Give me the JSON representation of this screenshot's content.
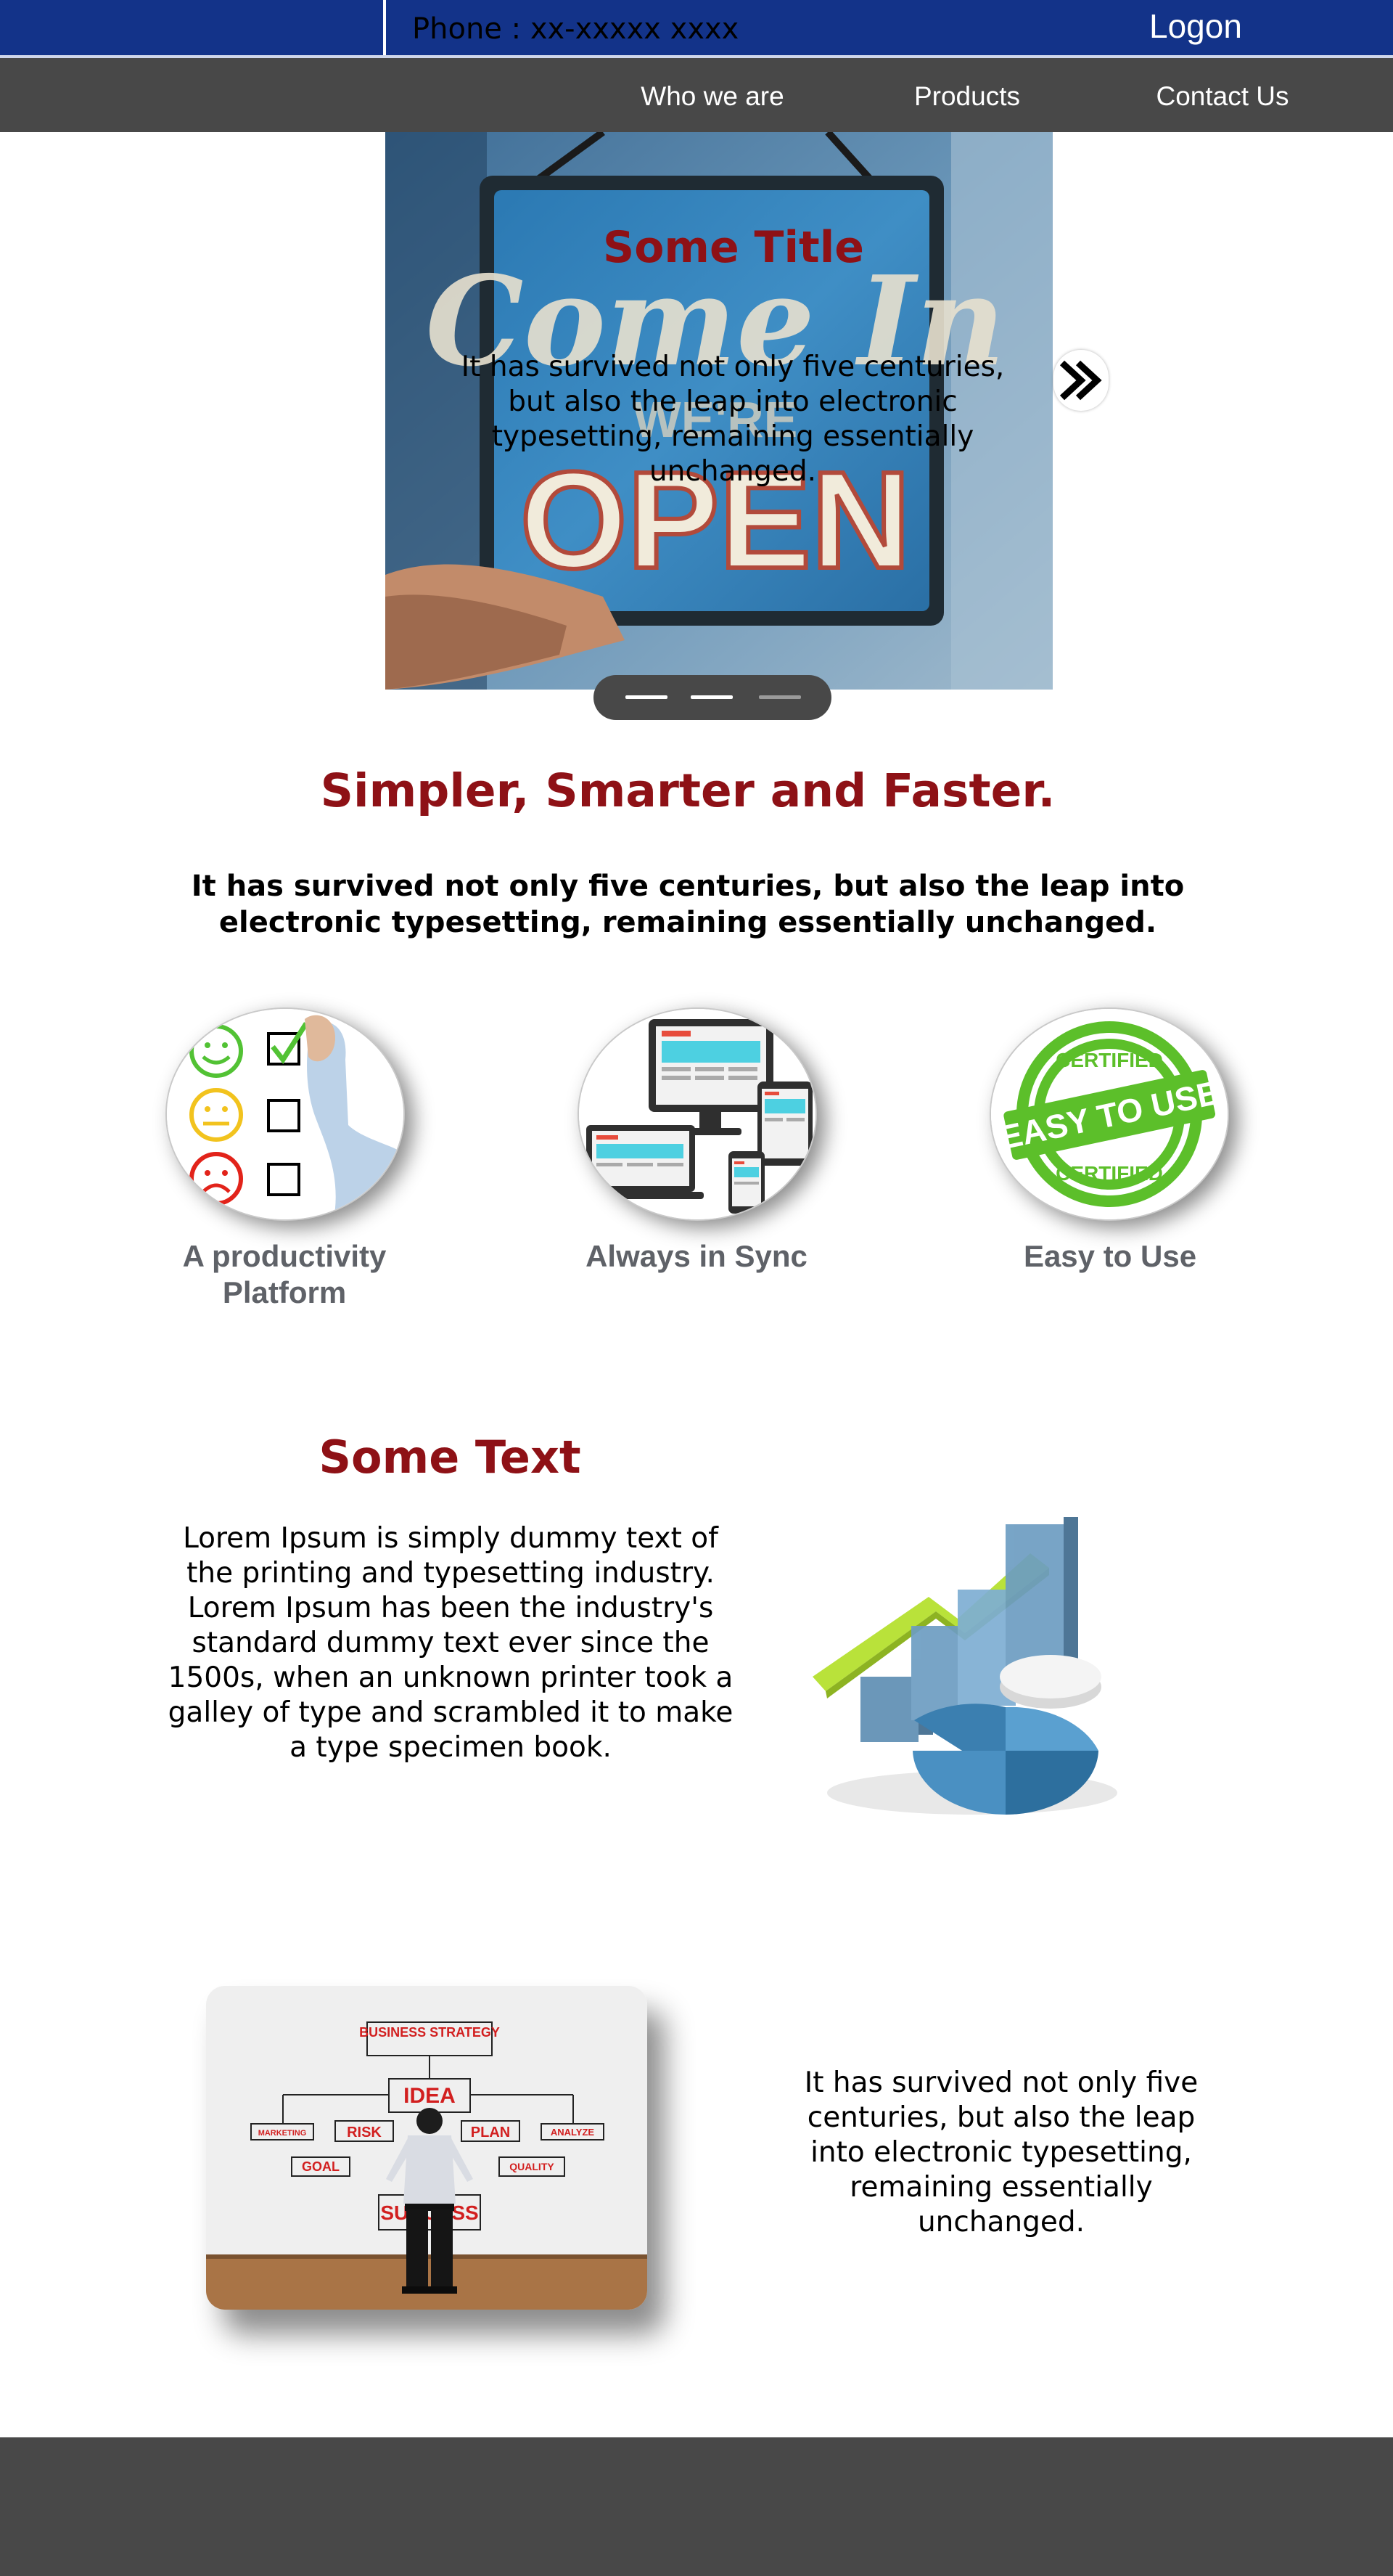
{
  "header": {
    "phone": "Phone : xx-xxxxx xxxx",
    "logon": "Logon",
    "bar_color": "#133389"
  },
  "nav": {
    "items": [
      "Who we are",
      "Products",
      "Contact Us"
    ],
    "bg_color": "#484848"
  },
  "hero": {
    "title": "Some Title",
    "text": "It has survived not only five centuries, but also the leap into electronic typesetting, remaining essentially unchanged.",
    "sign_words": [
      "Come In",
      "WE'RE",
      "OPEN"
    ],
    "next_icon": "double-chevron-right-icon",
    "slide_count": 3,
    "active_slide": 3
  },
  "intro": {
    "headline": "Simpler, Smarter and Faster.",
    "subline": "It has survived not only five centuries, but also the leap into electronic typesetting, remaining essentially unchanged."
  },
  "features": [
    {
      "label": "A productivity Platform",
      "icon": "feedback-checklist-icon"
    },
    {
      "label": "Always in Sync",
      "icon": "devices-sync-icon"
    },
    {
      "label": "Easy to Use",
      "icon": "certified-stamp-icon"
    }
  ],
  "certified_stamp": {
    "top": "CERTIFIED",
    "middle": "EASY TO USE",
    "bottom": "CERTIFIED"
  },
  "content": {
    "title": "Some Text",
    "body": "Lorem Ipsum is simply dummy text of the printing and typesetting industry. Lorem Ipsum has been the industry's standard dummy text ever since the 1500s, when an unknown printer took a galley of type and scrambled it to make a type specimen book.",
    "strategy_text": "It has survived not only five centuries, but also the leap into electronic typesetting, remaining essentially unchanged.",
    "strategy_board": {
      "top": "BUSINESS STRATEGY",
      "idea": "IDEA",
      "marketing": "MARKETING",
      "risk": "RISK",
      "plan": "PLAN",
      "analyze": "ANALYZE",
      "goal": "GOAL",
      "quality": "QUALITY",
      "success": "SUCCESS"
    }
  },
  "colors": {
    "accent": "#8e1116",
    "footer": "#484848",
    "feature_label": "#5f6268"
  }
}
